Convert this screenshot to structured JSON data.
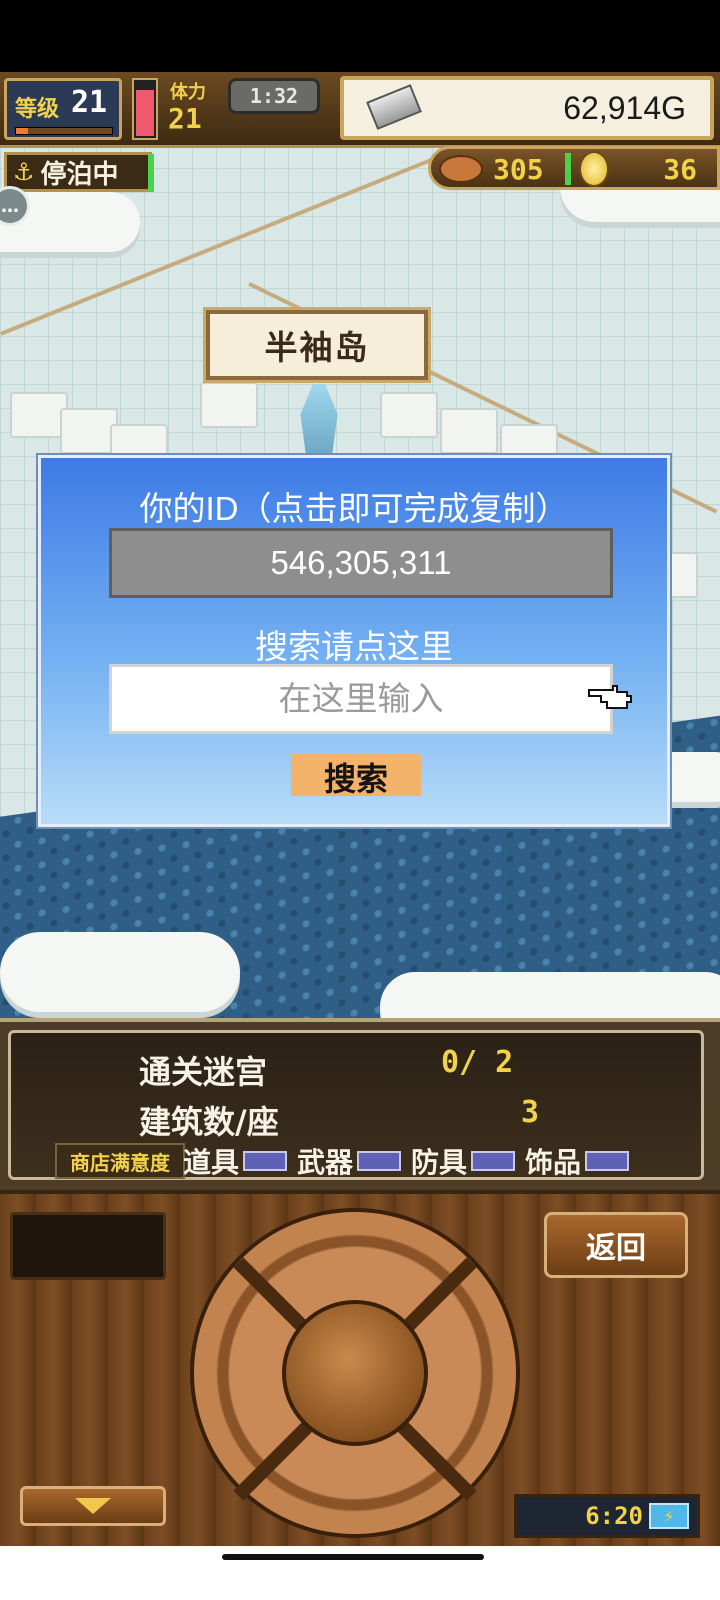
{
  "hud": {
    "level_label": "等级",
    "level": "21",
    "level_progress": 0.12,
    "hp_fraction": 0.85,
    "stamina_label": "体力",
    "stamina": "21",
    "clock": "1:32",
    "gold": "62,914G",
    "dock_status": "停泊中",
    "meat": "305",
    "coins": "36"
  },
  "map": {
    "island_name": "半袖岛"
  },
  "dialog": {
    "title": "你的ID（点击即可完成复制）",
    "user_id": "546,305,311",
    "search_hint": "搜索请点这里",
    "search_placeholder": "在这里输入",
    "search_button": "搜索"
  },
  "stats": {
    "dungeon_label": "通关迷宫",
    "dungeon_value": "0/ 2",
    "buildings_label": "建筑数/座",
    "buildings_value": "3",
    "shop_satisfaction_label": "商店满意度",
    "categories": [
      {
        "label": "道具",
        "color": "#5d62b6"
      },
      {
        "label": "武器",
        "color": "#5d62b6"
      },
      {
        "label": "防具",
        "color": "#5d62b6"
      },
      {
        "label": "饰品",
        "color": "#5d62b6"
      }
    ]
  },
  "controls": {
    "back_button": "返回",
    "down_icon": "down-arrow-icon",
    "game_time": "6:20",
    "battery_icon": "battery-charging-icon"
  },
  "icons": {
    "gold": "silver-bar-icon",
    "dock": "anchor-icon",
    "meat": "meat-icon",
    "coin": "coin-icon",
    "chat": "chat-icon",
    "pointer": "pointing-hand-icon"
  }
}
